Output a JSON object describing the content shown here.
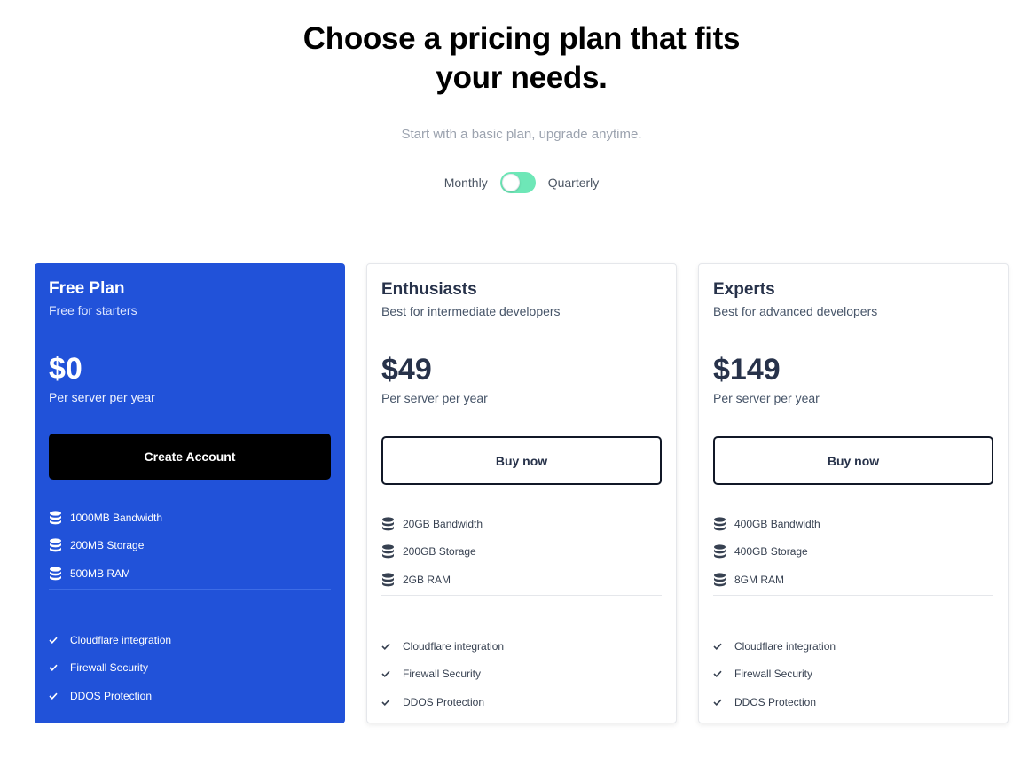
{
  "header": {
    "title_line1": "Choose a pricing plan that fits",
    "title_line2": "your needs.",
    "subtitle": "Start with a basic plan, upgrade anytime."
  },
  "billing": {
    "monthly_label": "Monthly",
    "quarterly_label": "Quarterly",
    "toggle_color": "#6ee7b7"
  },
  "plans": [
    {
      "name": "Free Plan",
      "description": "Free for starters",
      "price": "$0",
      "period": "Per server per year",
      "cta": "Create Account",
      "resources": [
        "1000MB Bandwidth",
        "200MB Storage",
        "500MB RAM"
      ],
      "features": [
        "Cloudflare integration",
        "Firewall Security",
        "DDOS Protection"
      ],
      "background": "#2152d9"
    },
    {
      "name": "Enthusiasts",
      "description": "Best for intermediate developers",
      "price": "$49",
      "period": "Per server per year",
      "cta": "Buy now",
      "resources": [
        "20GB Bandwidth",
        "200GB Storage",
        "2GB RAM"
      ],
      "features": [
        "Cloudflare integration",
        "Firewall Security",
        "DDOS Protection"
      ]
    },
    {
      "name": "Experts",
      "description": "Best for advanced developers",
      "price": "$149",
      "period": "Per server per year",
      "cta": "Buy now",
      "resources": [
        "400GB Bandwidth",
        "400GB Storage",
        "8GM RAM"
      ],
      "features": [
        "Cloudflare integration",
        "Firewall Security",
        "DDOS Protection"
      ]
    }
  ]
}
